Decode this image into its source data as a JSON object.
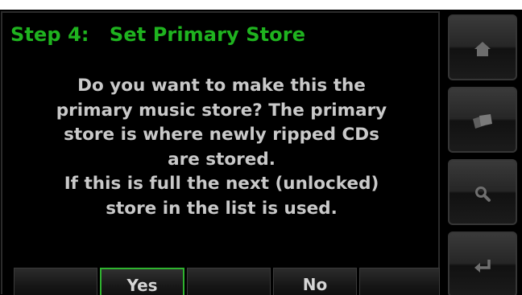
{
  "title": "Step 4:   Set Primary Store",
  "message": {
    "lines": [
      "Do you want to make this the",
      "primary music store? The primary",
      "store is where newly ripped CDs",
      "are stored.",
      "If this is full the next (unlocked)",
      "store in the list is used."
    ]
  },
  "buttons": {
    "yes_label": "Yes",
    "no_label": "No",
    "selected": "yes"
  },
  "side_buttons": [
    {
      "icon": "home-icon"
    },
    {
      "icon": "album-covers-icon"
    },
    {
      "icon": "search-icon"
    },
    {
      "icon": "back-enter-icon"
    }
  ],
  "colors": {
    "title": "#1fb31f",
    "text": "#c9c9c9",
    "selection": "#2fb32f",
    "background": "#000000"
  }
}
